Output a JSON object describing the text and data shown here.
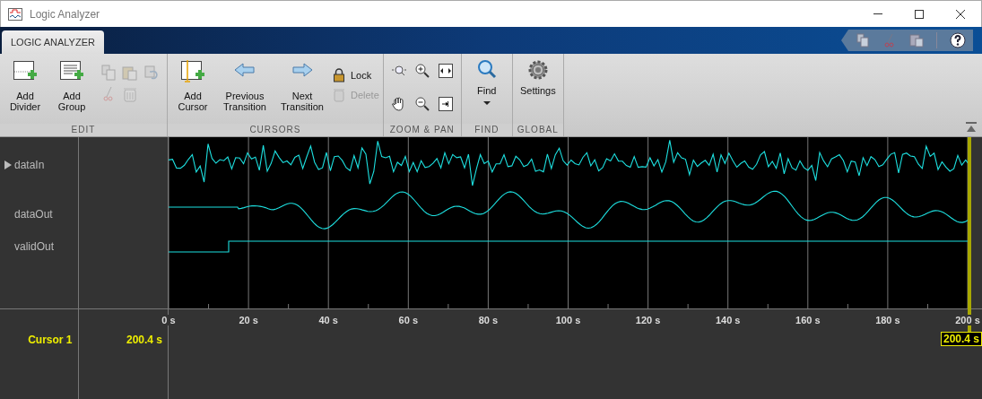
{
  "window": {
    "title": "Logic Analyzer"
  },
  "tab": {
    "label": "LOGIC ANALYZER",
    "selected": true
  },
  "ribbon": {
    "edit": {
      "label": "EDIT",
      "add_divider": "Add Divider",
      "add_group": "Add Group",
      "tools": [
        {
          "disabled": true
        },
        {
          "disabled": true
        },
        {
          "disabled": true
        },
        {
          "disabled": true
        },
        {
          "disabled": true
        }
      ]
    },
    "cursors": {
      "label": "CURSORS",
      "add_cursor": "Add Cursor",
      "previous": "Previous Transition",
      "next": "Next Transition",
      "lock": {
        "label": "Lock",
        "disabled": false
      },
      "delete": {
        "label": "Delete",
        "disabled": true
      }
    },
    "zoom_pan": {
      "label": "ZOOM & PAN"
    },
    "find": {
      "label": "FIND",
      "button": "Find"
    },
    "global": {
      "label": "GLOBAL",
      "button": "Settings"
    }
  },
  "signals": [
    {
      "name": "dataIn",
      "expandable": true
    },
    {
      "name": "dataOut",
      "expandable": false
    },
    {
      "name": "validOut",
      "expandable": false
    }
  ],
  "axis": {
    "ticks": [
      "0 s",
      "20 s",
      "40 s",
      "60 s",
      "80 s",
      "100 s",
      "120 s",
      "140 s",
      "160 s",
      "180 s",
      "200 s"
    ]
  },
  "cursor": {
    "name": "Cursor 1",
    "value": "200.4 s",
    "marker": "200.4 s"
  }
}
